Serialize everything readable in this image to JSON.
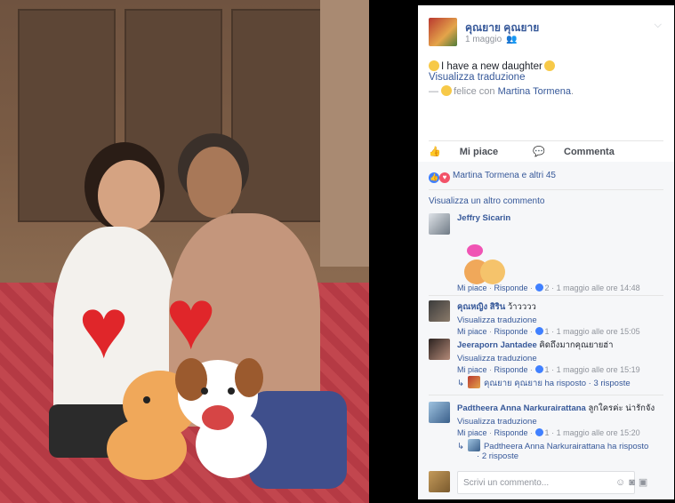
{
  "post": {
    "author": "คุณยาย คุณยาย",
    "date": "1 maggio",
    "text": "I have a new daughter",
    "translate": "Visualizza traduzione",
    "feeling_prefix": "—",
    "feeling": "felice con",
    "tagged": "Martina Tormena",
    "feeling_suffix": "."
  },
  "actions": {
    "like": "Mi piace",
    "comment": "Commenta"
  },
  "reactions": {
    "text": "Martina Tormena e altri 45"
  },
  "more_comments": "Visualizza un altro commento",
  "comments": [
    {
      "name": "Jeffry Sicarin",
      "text": "",
      "translate": "",
      "like": "Mi piace",
      "reply": "Risponde",
      "count": "2",
      "time": "1 maggio alle ore 14:48"
    },
    {
      "name": "คุณหญิง สิริน",
      "text": "ว้าวววว",
      "translate": "Visualizza traduzione",
      "like": "Mi piace",
      "reply": "Risponde",
      "count": "1",
      "time": "1 maggio alle ore 15:05"
    },
    {
      "name": "Jeeraporn Jantadee",
      "text": "คิดถึงมากคุณยายฮ่า",
      "translate": "Visualizza traduzione",
      "like": "Mi piace",
      "reply": "Risponde",
      "count": "1",
      "time": "1 maggio alle ore 15:19"
    },
    {
      "name": "Padtheera Anna Narkurairattana",
      "text": "ลูกใครค่ะ น่ารักจัง",
      "translate": "Visualizza traduzione",
      "like": "Mi piace",
      "reply": "Risponde",
      "count": "1",
      "time": "1 maggio alle ore 15:20"
    }
  ],
  "replies": [
    {
      "who": "คุณยาย คุณยาย ha risposto",
      "sep": "·",
      "count": "3 risposte"
    },
    {
      "who": "Padtheera Anna Narkurairattana ha risposto",
      "sep": "·",
      "count": "2 risposte"
    }
  ],
  "write": {
    "placeholder": "Scrivi un commento..."
  }
}
